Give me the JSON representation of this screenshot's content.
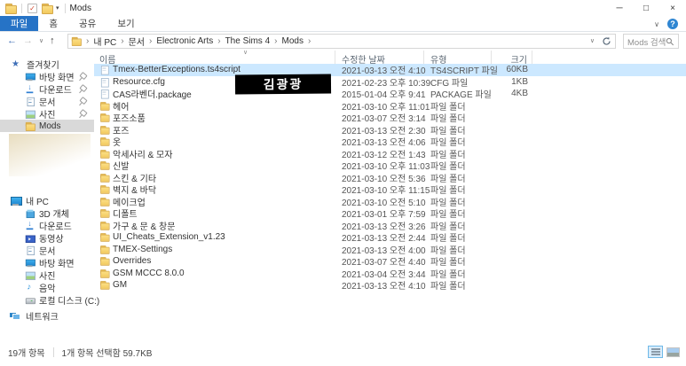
{
  "window": {
    "title": "Mods",
    "controls": {
      "minimize": "─",
      "maximize": "□",
      "close": "×"
    }
  },
  "icons": {
    "back": "←",
    "forward": "→",
    "up": "↑",
    "chevron_down": "∨",
    "qat_caret": "▾",
    "check": "✓",
    "breadcrumb_sep": "›",
    "sort_asc": "∨",
    "help": "?"
  },
  "colors": {
    "accent_tab_blue": "#2673c6",
    "row_selection_blue": "#cce8ff",
    "sidebar_selection_gray": "#d9d9d9",
    "folder_yellow": "#f2c95e"
  },
  "ribbon": {
    "tabs": [
      {
        "label": "파일",
        "active": true
      },
      {
        "label": "홈",
        "active": false
      },
      {
        "label": "공유",
        "active": false
      },
      {
        "label": "보기",
        "active": false
      }
    ]
  },
  "addressbar": {
    "breadcrumb": [
      "내 PC",
      "문서",
      "Electronic Arts",
      "The Sims 4",
      "Mods"
    ],
    "search_placeholder": "Mods 검색"
  },
  "sidebar": {
    "quick": {
      "label": "즐겨찾기",
      "items": [
        {
          "label": "바탕 화면",
          "icon": "desktop",
          "pinned": true
        },
        {
          "label": "다운로드",
          "icon": "download",
          "pinned": true
        },
        {
          "label": "문서",
          "icon": "document",
          "pinned": true
        },
        {
          "label": "사진",
          "icon": "picture",
          "pinned": true
        },
        {
          "label": "Mods",
          "icon": "folder",
          "selected": true
        }
      ]
    },
    "pc": {
      "label": "내 PC",
      "items": [
        {
          "label": "3D 개체",
          "icon": "cube"
        },
        {
          "label": "다운로드",
          "icon": "download"
        },
        {
          "label": "동영상",
          "icon": "video"
        },
        {
          "label": "문서",
          "icon": "document"
        },
        {
          "label": "바탕 화면",
          "icon": "desktop"
        },
        {
          "label": "사진",
          "icon": "picture"
        },
        {
          "label": "음악",
          "icon": "music"
        },
        {
          "label": "로컬 디스크 (C:)",
          "icon": "disk"
        }
      ]
    },
    "network": {
      "label": "네트워크"
    }
  },
  "filelist": {
    "columns": [
      "이름",
      "수정한 날짜",
      "유형",
      "크기"
    ],
    "rows": [
      {
        "icon": "file",
        "name": "Tmex-BetterExceptions.ts4script",
        "date": "2021-03-13 오전 4:10",
        "type": "TS4SCRIPT 파일",
        "size": "60KB",
        "selected": true
      },
      {
        "icon": "file",
        "name": "Resource.cfg",
        "date": "2021-02-23 오후 10:39",
        "type": "CFG 파일",
        "size": "1KB"
      },
      {
        "icon": "file",
        "name": "CAS라벤더.package",
        "date": "2015-01-04 오후 9:41",
        "type": "PACKAGE 파일",
        "size": "4KB"
      },
      {
        "icon": "folder",
        "name": "헤어",
        "date": "2021-03-10 오후 11:01",
        "type": "파일 폴더",
        "size": ""
      },
      {
        "icon": "folder",
        "name": "포즈소품",
        "date": "2021-03-07 오전 3:14",
        "type": "파일 폴더",
        "size": ""
      },
      {
        "icon": "folder",
        "name": "포즈",
        "date": "2021-03-13 오전 2:30",
        "type": "파일 폴더",
        "size": ""
      },
      {
        "icon": "folder",
        "name": "옷",
        "date": "2021-03-13 오전 4:06",
        "type": "파일 폴더",
        "size": ""
      },
      {
        "icon": "folder",
        "name": "악세사리 & 모자",
        "date": "2021-03-12 오전 1:43",
        "type": "파일 폴더",
        "size": ""
      },
      {
        "icon": "folder",
        "name": "신발",
        "date": "2021-03-10 오후 11:03",
        "type": "파일 폴더",
        "size": ""
      },
      {
        "icon": "folder",
        "name": "스킨 & 기타",
        "date": "2021-03-10 오전 5:36",
        "type": "파일 폴더",
        "size": ""
      },
      {
        "icon": "folder",
        "name": "벽지 & 바닥",
        "date": "2021-03-10 오후 11:15",
        "type": "파일 폴더",
        "size": ""
      },
      {
        "icon": "folder",
        "name": "메이크업",
        "date": "2021-03-10 오전 5:10",
        "type": "파일 폴더",
        "size": ""
      },
      {
        "icon": "folder",
        "name": "디폴트",
        "date": "2021-03-01 오후 7:59",
        "type": "파일 폴더",
        "size": ""
      },
      {
        "icon": "folder",
        "name": "가구 & 문 & 창문",
        "date": "2021-03-13 오전 3:26",
        "type": "파일 폴더",
        "size": ""
      },
      {
        "icon": "folder",
        "name": "UI_Cheats_Extension_v1.23",
        "date": "2021-03-13 오전 2:44",
        "type": "파일 폴더",
        "size": ""
      },
      {
        "icon": "folder",
        "name": "TMEX-Settings",
        "date": "2021-03-13 오전 4:00",
        "type": "파일 폴더",
        "size": ""
      },
      {
        "icon": "folder",
        "name": "Overrides",
        "date": "2021-03-07 오전 4:40",
        "type": "파일 폴더",
        "size": ""
      },
      {
        "icon": "folder",
        "name": "GSM MCCC 8.0.0",
        "date": "2021-03-04 오전 3:44",
        "type": "파일 폴더",
        "size": ""
      },
      {
        "icon": "folder",
        "name": "GM",
        "date": "2021-03-13 오전 4:10",
        "type": "파일 폴더",
        "size": ""
      }
    ]
  },
  "watermark": {
    "text": "김광광"
  },
  "statusbar": {
    "item_count": "19개 항목",
    "selection": "1개 항목 선택함 59.7KB"
  }
}
